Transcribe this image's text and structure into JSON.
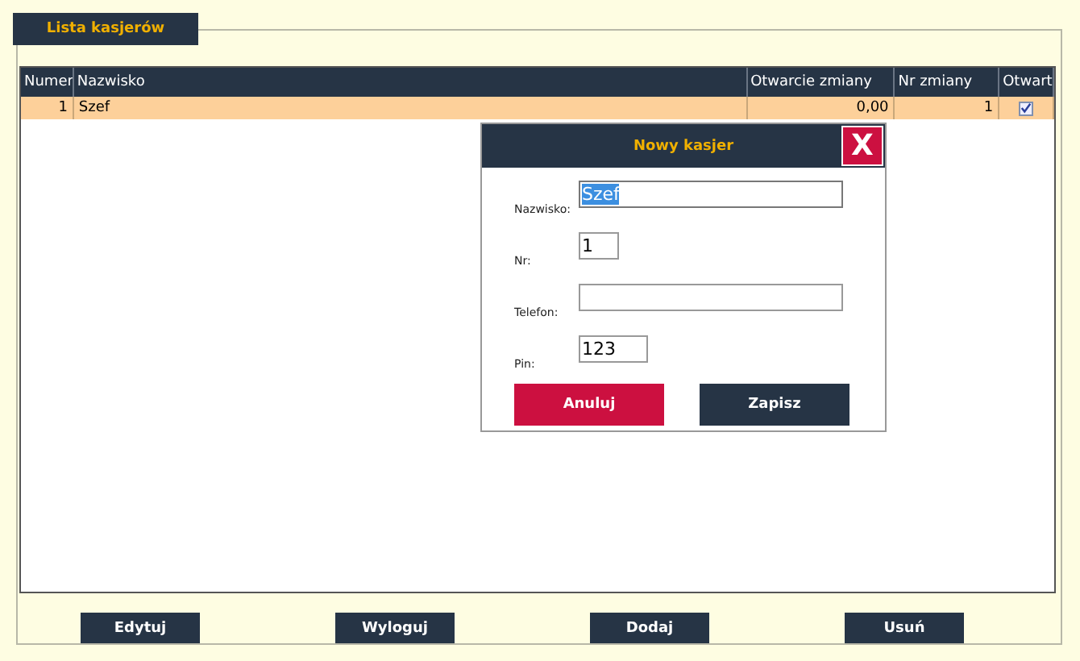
{
  "panel": {
    "tab": "Lista kasjerów"
  },
  "table": {
    "columns": [
      "Numer",
      "Nazwisko",
      "Otwarcie zmiany",
      "Nr zmiany",
      "Otwart"
    ],
    "rows": [
      {
        "number": "1",
        "name": "Szef",
        "shift_open": "0,00",
        "shift_no": "1",
        "open": true,
        "selected": true
      }
    ]
  },
  "dialog": {
    "title": "Nowy kasjer",
    "close": "X",
    "fields": [
      {
        "label": "Nazwisko:",
        "value": "Szef",
        "highlighted": true
      },
      {
        "label": "Nr:",
        "value": "1",
        "highlighted": false
      },
      {
        "label": "Telefon:",
        "highlighted": false
      },
      {
        "label": "Pin:",
        "value": "123",
        "highlighted": false
      }
    ],
    "buttons": [
      {
        "label": "Anuluj",
        "kind": "cancel"
      },
      {
        "label": "Zapisz",
        "kind": "save"
      }
    ]
  },
  "buttons": [
    "Edytuj",
    "Wyloguj",
    "Dodaj",
    "Usuń"
  ]
}
